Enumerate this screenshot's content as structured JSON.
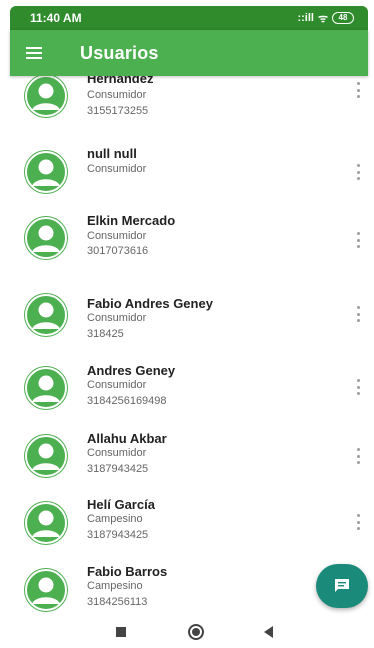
{
  "status_bar": {
    "time": "11:40 AM",
    "signal": "::ill",
    "wifi": "ᯤ",
    "battery": "48"
  },
  "app_bar": {
    "title": "Usuarios"
  },
  "users": [
    {
      "name": "Hernandez",
      "role": "Consumidor",
      "phone": "3155173255"
    },
    {
      "name": "null null",
      "role": "Consumidor",
      "phone": ""
    },
    {
      "name": "Elkin Mercado",
      "role": "Consumidor",
      "phone": "3017073616"
    },
    {
      "name": "Fabio Andres Geney",
      "role": "Consumidor",
      "phone": "318425"
    },
    {
      "name": "Andres Geney",
      "role": "Consumidor",
      "phone": "3184256169498"
    },
    {
      "name": "Allahu  Akbar",
      "role": "Consumidor",
      "phone": "3187943425"
    },
    {
      "name": "Helí García",
      "role": "Campesino",
      "phone": "3187943425"
    },
    {
      "name": "Fabio  Barros",
      "role": "Campesino",
      "phone": "3184256113"
    }
  ],
  "icons": {
    "menu": "menu-icon",
    "avatar": "person-avatar-icon",
    "more": "more-vert-icon",
    "fab": "chat-icon"
  },
  "colors": {
    "status_bar": "#2f8b2b",
    "app_bar": "#4caf50",
    "fab": "#1a8a7a"
  }
}
